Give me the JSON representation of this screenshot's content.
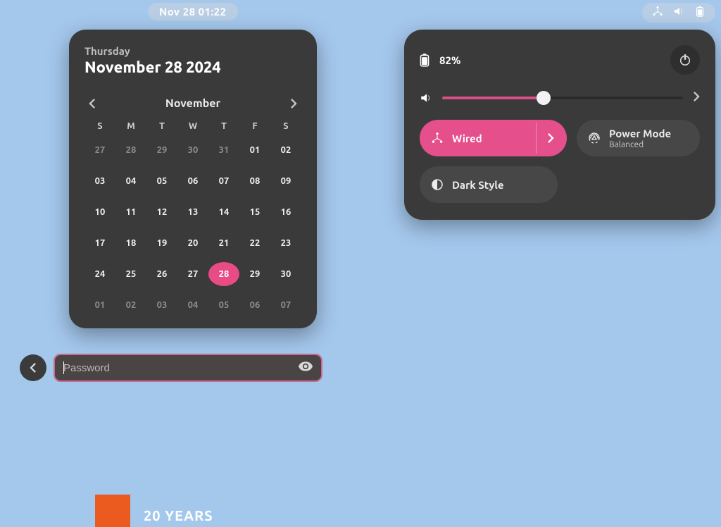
{
  "topbar": {
    "clock": "Nov 28  01:22"
  },
  "calendar": {
    "day_name": "Thursday",
    "full_date": "November 28 2024",
    "month_label": "November",
    "dow": [
      "S",
      "M",
      "T",
      "W",
      "T",
      "F",
      "S"
    ],
    "grid": [
      [
        {
          "d": "27",
          "o": true
        },
        {
          "d": "28",
          "o": true
        },
        {
          "d": "29",
          "o": true
        },
        {
          "d": "30",
          "o": true
        },
        {
          "d": "31",
          "o": true
        },
        {
          "d": "01"
        },
        {
          "d": "02"
        }
      ],
      [
        {
          "d": "03"
        },
        {
          "d": "04"
        },
        {
          "d": "05"
        },
        {
          "d": "06"
        },
        {
          "d": "07"
        },
        {
          "d": "08"
        },
        {
          "d": "09"
        }
      ],
      [
        {
          "d": "10"
        },
        {
          "d": "11"
        },
        {
          "d": "12"
        },
        {
          "d": "13"
        },
        {
          "d": "14"
        },
        {
          "d": "15"
        },
        {
          "d": "16"
        }
      ],
      [
        {
          "d": "17"
        },
        {
          "d": "18"
        },
        {
          "d": "19"
        },
        {
          "d": "20"
        },
        {
          "d": "21"
        },
        {
          "d": "22"
        },
        {
          "d": "23"
        }
      ],
      [
        {
          "d": "24"
        },
        {
          "d": "25"
        },
        {
          "d": "26"
        },
        {
          "d": "27"
        },
        {
          "d": "28",
          "t": true
        },
        {
          "d": "29"
        },
        {
          "d": "30"
        }
      ],
      [
        {
          "d": "01",
          "o": true
        },
        {
          "d": "02",
          "o": true
        },
        {
          "d": "03",
          "o": true
        },
        {
          "d": "04",
          "o": true
        },
        {
          "d": "05",
          "o": true
        },
        {
          "d": "06",
          "o": true
        },
        {
          "d": "07",
          "o": true
        }
      ]
    ]
  },
  "password": {
    "placeholder": "Password"
  },
  "quick_settings": {
    "battery_pct": "82%",
    "volume_pct": 42,
    "wired_label": "Wired",
    "power_mode_label": "Power Mode",
    "power_mode_value": "Balanced",
    "dark_style_label": "Dark Style"
  },
  "footer": {
    "years": "20 YEARS"
  },
  "colors": {
    "accent": "#e54f8b",
    "panel": "#3a3a3a",
    "wallpaper": "#a4c7ec",
    "orange": "#eb5a1f"
  }
}
